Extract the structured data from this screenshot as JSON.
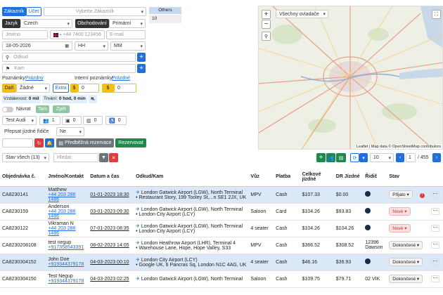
{
  "form": {
    "tab_customer": "Zákazník",
    "tab_account": "Účet",
    "customer_select": "Vyberte Zákazník",
    "others_label": "Others",
    "others_value": "10",
    "language_label": "Jazyk",
    "language_value": "Czech",
    "dealer_label": "Obchodování",
    "dealer_value": "Primární",
    "name_placeholder": "Jméno",
    "phone_placeholder": "+44 7400 123456",
    "email_placeholder": "E-mail",
    "date_value": "18-05-2026",
    "hour_value": "HH",
    "minute_value": "MM",
    "pickup_placeholder": "Odkud",
    "dropoff_placeholder": "Kam",
    "notes_label": "Poznámky:",
    "notes_link": "Prázdný",
    "internal_notes_label": "Interní poznámky:",
    "internal_notes_link": "Prázdné",
    "tax_label": "Daň",
    "tax_value": "Žádné",
    "extra_label": "Extra",
    "extra_value": "0",
    "price_value": "0",
    "distance_label": "Vzdálenost:",
    "distance_value": "0 mil",
    "duration_label": "Trvání:",
    "duration_value": "0 hod, 0 min",
    "return_label": "Návrat",
    "there_label": "Tam",
    "back_label": "Zpět",
    "vehicle_value": "Test Audi",
    "passengers_value": "1",
    "luggage_value": "0",
    "hand_luggage_value": "0",
    "child_seats_value": "0",
    "override_driver_label": "Přepsat jízdné řidiče",
    "override_driver_value": "Ne",
    "prebook_label": "Předběžná rezervace",
    "reserve_label": "Rezervovat"
  },
  "map": {
    "layer_select": "Všechny ovladače",
    "zoom_in": "+",
    "zoom_out": "−",
    "attribution": "Leaflet | Map data © OpenStreetMap contributors"
  },
  "toolbar": {
    "status_filter": "Stav všech (13)",
    "search_placeholder": "Hledat",
    "per_page": "10",
    "page_current": "1",
    "page_total": "/ 455"
  },
  "table": {
    "headers": [
      "Objednávka č.",
      "Jméno/Kontakt",
      "Datum a čas",
      "Odkud/Kam",
      "Vůz",
      "Platba",
      "Celkové jízdné",
      "DR Jízdné",
      "Řidič",
      "Stav",
      ""
    ],
    "rows": [
      {
        "id": "CA8230141",
        "name": "Matthew",
        "phone": "+44 203 286 1486",
        "date": "01-01-2023 18:30",
        "from": "London Gatwick Airport (LGW), North Terminal",
        "to": "Restaurant Story, 199 Tooley St,...n SE1 2JX, UK",
        "car": "MPV",
        "pay": "Cash",
        "total": "$107.33",
        "dr": "$0.00",
        "driver": "",
        "status": "Přijato"
      },
      {
        "id": "CA8230159",
        "name": "Anderson",
        "phone": "+44 203 286 1486",
        "date": "03-01-2023 09:30",
        "from": "London Gatwick Airport (LGW), North Terminal",
        "to": "London City Airport (LCY)",
        "car": "Saloon",
        "pay": "Card",
        "total": "$104.26",
        "dr": "$93.83",
        "driver": "",
        "status": "Nové"
      },
      {
        "id": "CA8230122",
        "name": "Vikraman N",
        "phone": "+44 203 286 1486",
        "date": "07-01-2023 08:35",
        "from": "London Gatwick Airport (LGW), North Terminal",
        "to": "London City Airport (LCY)",
        "car": "4 seater",
        "pay": "Cash",
        "total": "$104.26",
        "dr": "$104.26",
        "driver": "",
        "status": "Nové"
      },
      {
        "id": "CA8230208108",
        "name": "test negup",
        "phone": "+917358543391",
        "date": "08-02-2023 14:05",
        "from": "London Heathrow Airport (LHR), Terminal 4",
        "to": "Warehouse Lane, Hope, Hope Valley, S33",
        "car": "MPV",
        "pay": "Cash",
        "total": "$366.52",
        "dr": "$308.52",
        "driver": "12396 Dawson",
        "status": "Dokončené"
      },
      {
        "id": "CA8230304152",
        "name": "John Doe",
        "phone": "+919344379178",
        "date": "04-03-2023 00:10",
        "from": "London City Airport (LCY)",
        "to": "Google UK, 6 Pancras Sq, London N1C 4AG, UK",
        "car": "4 seater",
        "pay": "Cash",
        "total": "$46.16",
        "dr": "$36.93",
        "driver": "",
        "status": "Dokončené"
      },
      {
        "id": "CA8230304150",
        "name": "Test Negup",
        "phone": "+919344379178",
        "date": "04-03-2023 02:25",
        "from": "London Gatwick Airport (LGW), North Terminal",
        "to": "",
        "car": "Saloon",
        "pay": "Cash",
        "total": "$109.75",
        "dr": "$79.71",
        "driver": "02 VIK",
        "status": "Dokončené"
      }
    ]
  },
  "colors": {
    "primary": "#1e6fe0",
    "success": "#1b8a4a",
    "dark": "#333333",
    "warning": "#f4c20d",
    "danger": "#e23b3b",
    "selected_row": "#dbe8f8"
  }
}
